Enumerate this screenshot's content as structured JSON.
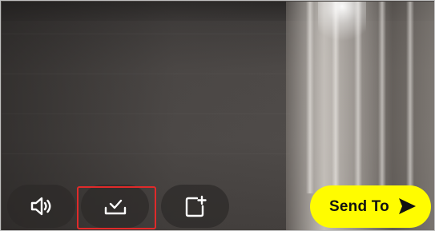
{
  "toolbar": {
    "sound_icon": "speaker-icon",
    "save_icon": "download-check-icon",
    "add_story_icon": "add-to-story-icon"
  },
  "send": {
    "label": "Send To",
    "icon": "send-arrow-icon",
    "background_color": "#fffc00"
  },
  "highlight_color": "#e02a2a"
}
